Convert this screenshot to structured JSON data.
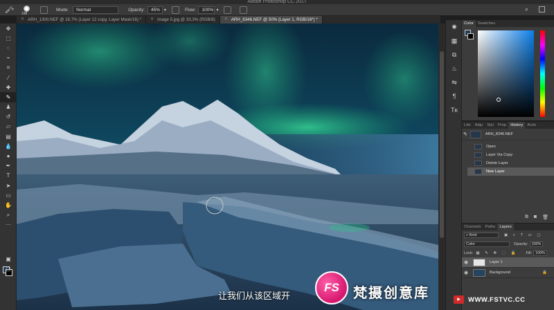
{
  "window": {
    "title": "Adobe Photoshop CC 2017"
  },
  "options_bar": {
    "brush_size": "198",
    "mode_label": "Mode:",
    "mode_value": "Normal",
    "opacity_label": "Opacity:",
    "opacity_value": "45%",
    "flow_label": "Flow:",
    "flow_value": "100%"
  },
  "document_tabs": [
    {
      "label": "ARH_1300.NEF @ 16,7% (Layer 12 copy, Layer Mask/16) *"
    },
    {
      "label": "image 5.jpg @ 33,3% (RGB/8)"
    },
    {
      "label": "ARH_8346.NEF @ 50% (Layer 1, RGB/16*) *"
    }
  ],
  "color_panel": {
    "tabs": [
      "Color",
      "Swatches"
    ],
    "foreground": "#1f3b55",
    "background": "#000000",
    "field_hue": "#0c7fe9"
  },
  "history_panel": {
    "tabs": [
      "Libr",
      "Adju",
      "Styl",
      "Prop",
      "History",
      "Actio"
    ],
    "snapshot": "ARH_8346.NEF",
    "states": [
      "Open",
      "Layer Via Copy",
      "Delete Layer",
      "New Layer"
    ],
    "selected_index": 3
  },
  "layers_panel": {
    "tabs": [
      "Channels",
      "Paths",
      "Layers"
    ],
    "kind_label": "Kind",
    "blend_mode": "Color",
    "opacity_label": "Opacity:",
    "opacity_value": "100%",
    "lock_label": "Lock:",
    "fill_label": "Fill:",
    "fill_value": "100%",
    "layers": [
      {
        "name": "Layer 1"
      },
      {
        "name": "Background"
      }
    ]
  },
  "overlay": {
    "subtitle": "让我们从该区域开",
    "watermark_logo": "FS",
    "watermark_text": "梵摄创意库",
    "watermark_url": "WWW.FSTVC.CC"
  }
}
